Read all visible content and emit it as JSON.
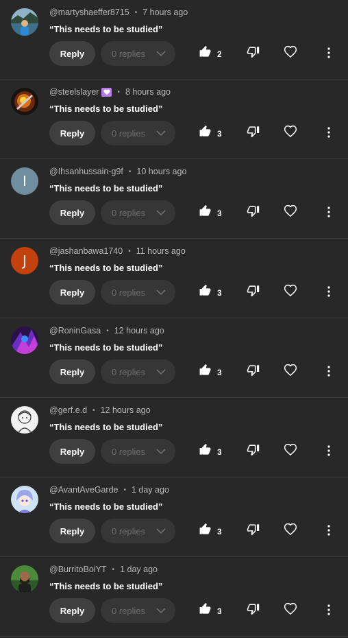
{
  "labels": {
    "reply": "Reply",
    "replies": "0 replies"
  },
  "comments": [
    {
      "author": "@martyshaeffer8715",
      "time": "7 hours ago",
      "text": "“This needs to be studied”",
      "likes": "2",
      "avatar": "image-lake",
      "badge": false
    },
    {
      "author": "@steelslayer",
      "time": "8 hours ago",
      "text": "“This needs to be studied”",
      "likes": "3",
      "avatar": "image-fire",
      "badge": true
    },
    {
      "author": "@Ihsanhussain-g9f",
      "time": "10 hours ago",
      "text": "“This needs to be studied”",
      "likes": "3",
      "avatar": "letter",
      "avatar_letter": "I",
      "avatar_color": "#6f8fa0",
      "badge": false
    },
    {
      "author": "@jashanbawa1740",
      "time": "11 hours ago",
      "text": "“This needs to be studied”",
      "likes": "3",
      "avatar": "letter",
      "avatar_letter": "J",
      "avatar_color": "#c2410c",
      "badge": false
    },
    {
      "author": "@RoninGasa",
      "time": "12 hours ago",
      "text": "“This needs to be studied”",
      "likes": "3",
      "avatar": "image-purple",
      "badge": false
    },
    {
      "author": "@gerf.e.d",
      "time": "12 hours ago",
      "text": "“This needs to be studied”",
      "likes": "3",
      "avatar": "image-sketch",
      "badge": false
    },
    {
      "author": "@AvantAveGarde",
      "time": "1 day ago",
      "text": "“This needs to be studied”",
      "likes": "3",
      "avatar": "image-anime",
      "badge": false
    },
    {
      "author": "@BurritoBoiYT",
      "time": "1 day ago",
      "text": "“This needs to be studied”",
      "likes": "3",
      "avatar": "image-man",
      "badge": false
    }
  ],
  "icons": {
    "like": "thumbs-up-icon",
    "dislike": "thumbs-down-icon",
    "heart": "heart-icon",
    "more": "more-vert-icon",
    "chevron": "chevron-down-icon"
  }
}
